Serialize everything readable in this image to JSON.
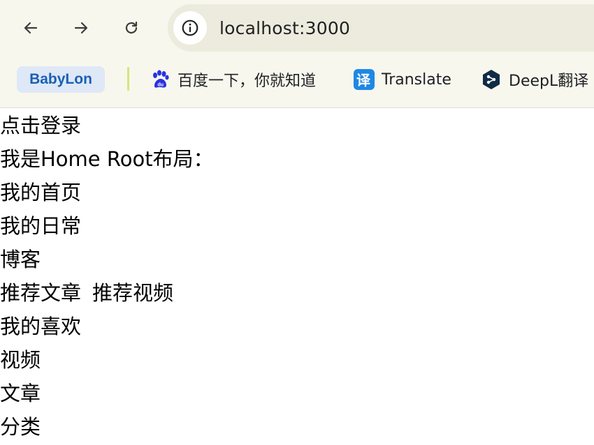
{
  "browser": {
    "url": "localhost:3000",
    "icons": {
      "back": "arrow-left-icon",
      "forward": "arrow-right-icon",
      "reload": "reload-icon",
      "site_info": "info-icon"
    }
  },
  "bookmarks": {
    "babylon": "BabyLon",
    "baidu": "百度一下，你就知道",
    "translate": "Translate",
    "deepl": "DeepL翻译"
  },
  "page": {
    "login": "点击登录",
    "layout_label": "我是Home Root布局：",
    "my_home": "我的首页",
    "my_daily": "我的日常",
    "blog": "博客",
    "recommended_articles": "推荐文章",
    "recommended_videos": "推荐视频",
    "my_favorites": "我的喜欢",
    "videos": "视频",
    "articles": "文章",
    "categories": "分类"
  },
  "colors": {
    "toolbar_bg": "#f7f7ee",
    "babylon_bg": "#dee8f6",
    "babylon_text": "#1a5fb4",
    "translate_blue": "#1e88e5",
    "deepl_navy": "#0f2b46",
    "baidu_blue": "#2932e1"
  }
}
